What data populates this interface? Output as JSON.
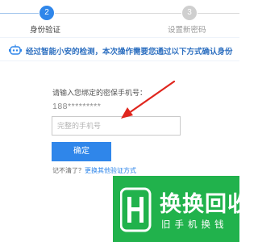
{
  "stepper": {
    "step1_number": "2",
    "step1_label": "身份验证",
    "step2_number": "3",
    "step2_label": "设置新密码"
  },
  "banner": {
    "icon": "robot-icon",
    "text": "经过智能小安的检测，本次操作需要您通过以下方式确认身份"
  },
  "form": {
    "prompt": "请输入您绑定的密保手机号：",
    "masked_phone": "188*********",
    "phone_placeholder": "完整的手机号",
    "phone_value": "",
    "confirm_label": "确定",
    "forgot_text": "记不清了？",
    "other_method_link": "更换其他验证方式"
  },
  "watermark": {
    "title": "换换回收",
    "subtitle": "旧手机换钱"
  },
  "colors": {
    "accent_blue": "#2f86ea",
    "annotation_red": "#e0261e",
    "watermark_green": "#21b24c"
  }
}
